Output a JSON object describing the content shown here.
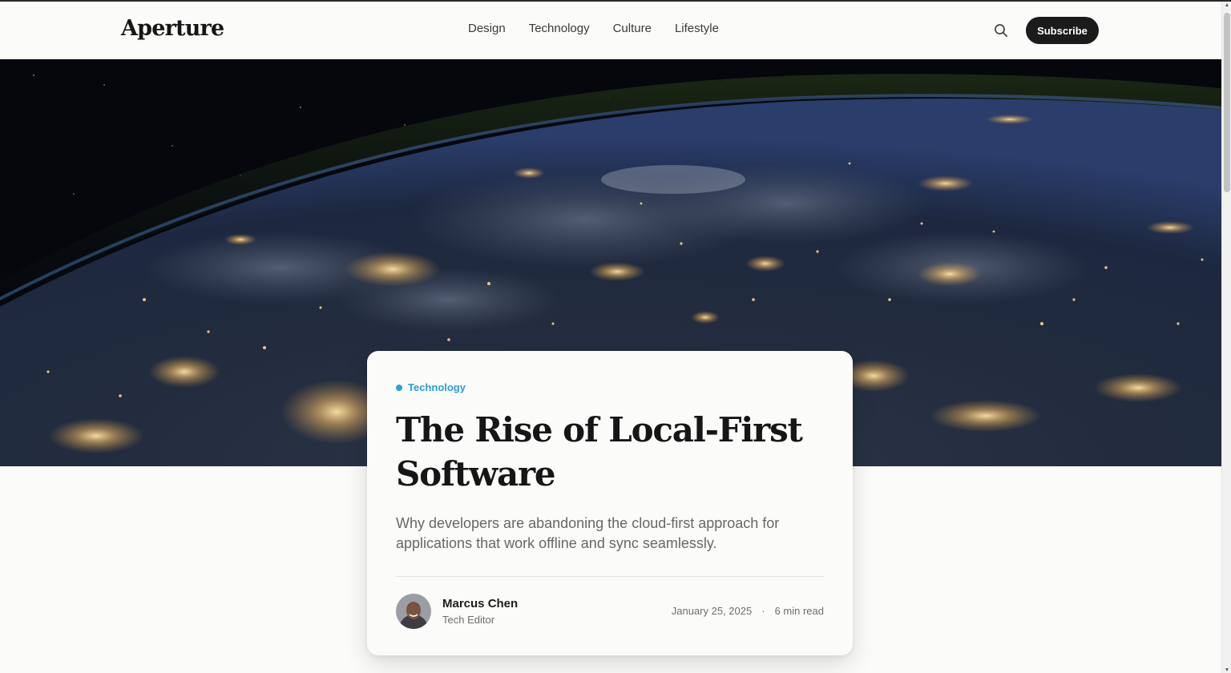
{
  "header": {
    "logo": "Aperture",
    "nav": [
      "Design",
      "Technology",
      "Culture",
      "Lifestyle"
    ],
    "search_icon": "search-icon",
    "subscribe_label": "Subscribe"
  },
  "hero": {
    "image": "earth-at-night-from-space"
  },
  "article": {
    "category": "Technology",
    "category_color": "#2a9fd8",
    "title": "The Rise of Local-First Software",
    "dek": "Why developers are abandoning the cloud-first approach for applications that work offline and sync seamlessly.",
    "author": {
      "name": "Marcus Chen",
      "role": "Tech Editor",
      "avatar_icon": "author-avatar"
    },
    "date": "January 25, 2025",
    "separator": "·",
    "read_time": "6 min read"
  },
  "colors": {
    "background": "#fbfbf9",
    "button_dark": "#1b1b1b",
    "text_muted": "#676767"
  }
}
